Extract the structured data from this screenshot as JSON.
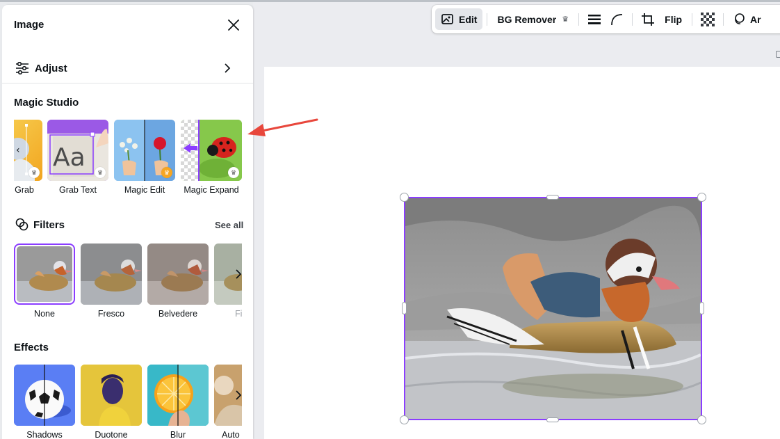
{
  "toolbar": {
    "edit_label": "Edit",
    "bg_remover_label": "BG Remover",
    "flip_label": "Flip",
    "animate_label": "Ar"
  },
  "panel": {
    "title": "Image",
    "adjust_label": "Adjust",
    "magic_studio": {
      "heading": "Magic Studio",
      "items": [
        {
          "label": "Grab"
        },
        {
          "label": "Grab Text"
        },
        {
          "label": "Magic Edit"
        },
        {
          "label": "Magic Expand"
        }
      ]
    },
    "filters": {
      "heading": "Filters",
      "see_all": "See all",
      "items": [
        {
          "label": "None"
        },
        {
          "label": "Fresco"
        },
        {
          "label": "Belvedere"
        },
        {
          "label": "Fi"
        }
      ]
    },
    "effects": {
      "heading": "Effects",
      "items": [
        {
          "label": "Shadows"
        },
        {
          "label": "Duotone"
        },
        {
          "label": "Blur"
        },
        {
          "label": "Auto"
        }
      ]
    }
  },
  "colors": {
    "accent": "#8b3dff",
    "annotation_arrow": "#e8473c"
  }
}
